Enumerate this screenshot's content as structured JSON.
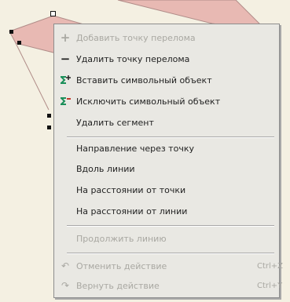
{
  "menu": {
    "items": [
      {
        "label": "Добавить точку перелома",
        "icon": "plus-icon",
        "disabled": true
      },
      {
        "label": "Удалить точку перелома",
        "icon": "minus-icon",
        "disabled": false
      },
      {
        "label": "Вставить символьный объект",
        "icon": "insert-symbol-icon",
        "disabled": false
      },
      {
        "label": "Исключить символьный объект",
        "icon": "exclude-symbol-icon",
        "disabled": false
      },
      {
        "label": "Удалить сегмент",
        "icon": "",
        "disabled": false
      },
      {
        "label": "Направление через точку",
        "icon": "",
        "disabled": false
      },
      {
        "label": "Вдоль линии",
        "icon": "",
        "disabled": false
      },
      {
        "label": "На расстоянии от точки",
        "icon": "",
        "disabled": false
      },
      {
        "label": "На расстоянии от линии",
        "icon": "",
        "disabled": false
      },
      {
        "label": "Продолжить линию",
        "icon": "",
        "disabled": true
      },
      {
        "label": "Отменить действие",
        "icon": "undo-icon",
        "shortcut": "Ctrl+Z",
        "disabled": true
      },
      {
        "label": "Вернуть действие",
        "icon": "redo-icon",
        "shortcut": "Ctrl+Y",
        "disabled": true
      }
    ]
  },
  "colors": {
    "background": "#f4f0e2",
    "shape_fill": "#e8b9b3",
    "menu_bg": "#e9e8e3",
    "accent_green": "#1b8f5a"
  }
}
